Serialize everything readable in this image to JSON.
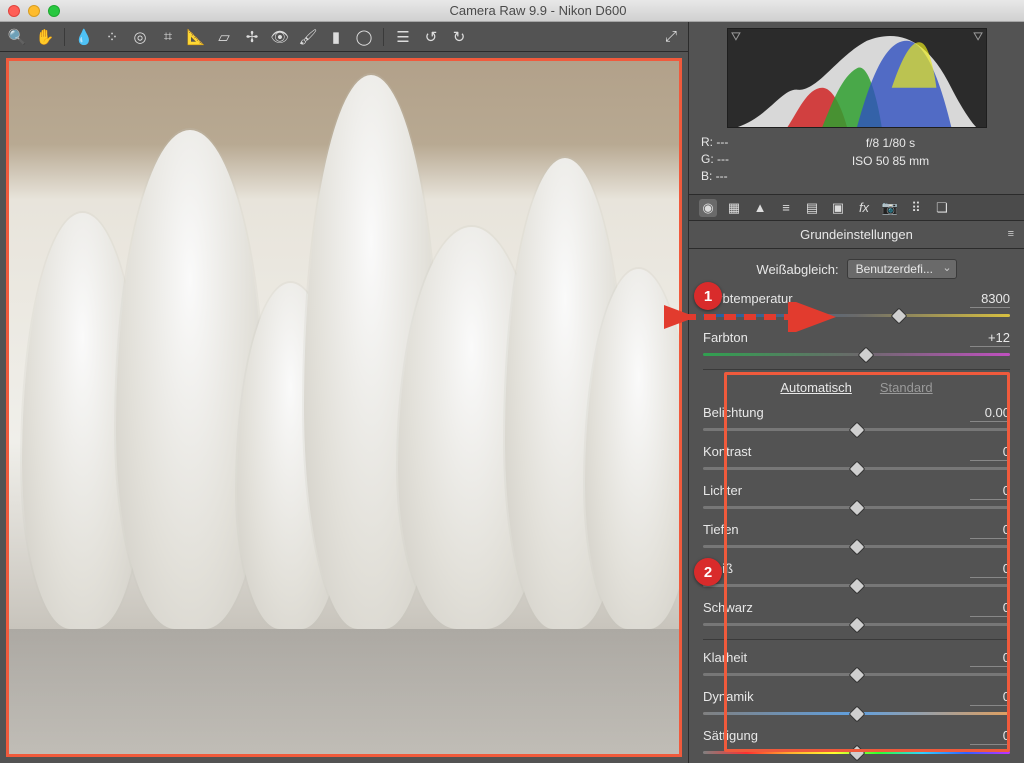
{
  "window": {
    "title": "Camera Raw 9.9 - Nikon D600"
  },
  "camera": {
    "r": "R:   ---",
    "g": "G:   ---",
    "b": "B:   ---",
    "aperture_shutter": "f/8   1/80 s",
    "iso_focal": "ISO 50   85 mm"
  },
  "panel": {
    "title": "Grundeinstellungen",
    "wb_label": "Weißabgleich:",
    "wb_preset": "Benutzerdefi...",
    "auto": "Automatisch",
    "standard": "Standard"
  },
  "sliders": {
    "temp": {
      "label": "Farbtemperatur",
      "value": "8300",
      "pos": 64
    },
    "tint": {
      "label": "Farbton",
      "value": "+12",
      "pos": 53
    },
    "exposure": {
      "label": "Belichtung",
      "value": "0.00",
      "pos": 50
    },
    "contrast": {
      "label": "Kontrast",
      "value": "0",
      "pos": 50
    },
    "highlights": {
      "label": "Lichter",
      "value": "0",
      "pos": 50
    },
    "shadows": {
      "label": "Tiefen",
      "value": "0",
      "pos": 50
    },
    "whites": {
      "label": "Weiß",
      "value": "0",
      "pos": 50
    },
    "blacks": {
      "label": "Schwarz",
      "value": "0",
      "pos": 50
    },
    "clarity": {
      "label": "Klarheit",
      "value": "0",
      "pos": 50
    },
    "vibrance": {
      "label": "Dynamik",
      "value": "0",
      "pos": 50
    },
    "saturation": {
      "label": "Sättigung",
      "value": "0",
      "pos": 50
    }
  },
  "annotations": {
    "badge1": "1",
    "badge2": "2"
  }
}
